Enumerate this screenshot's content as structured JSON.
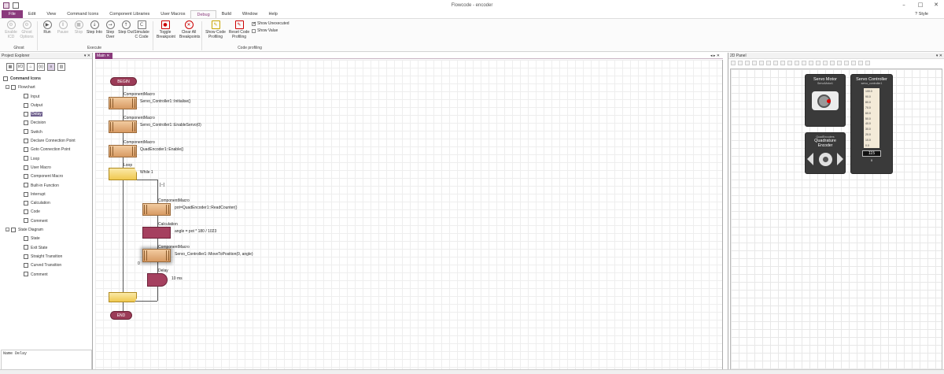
{
  "window": {
    "title": "Flowcode - encoder",
    "style_label": "Style"
  },
  "menu": [
    "File",
    "Edit",
    "View",
    "Command Icons",
    "Component Libraries",
    "User Macros",
    "Debug",
    "Build",
    "Window",
    "Help"
  ],
  "ribbon": {
    "buttons": [
      {
        "label": "Enable ICD",
        "icon": "⚙",
        "disabled": true
      },
      {
        "label": "Ghost Options",
        "icon": "⚙",
        "disabled": true
      },
      {
        "label": "Run",
        "icon": "▶"
      },
      {
        "label": "Pause",
        "icon": "Ⅱ",
        "disabled": true
      },
      {
        "label": "Stop",
        "icon": "■",
        "disabled": true
      },
      {
        "label": "Step Into",
        "icon": "↓"
      },
      {
        "label": "Step Over",
        "icon": "→"
      },
      {
        "label": "Step Out",
        "icon": "↑"
      },
      {
        "label": "Simulate C Code",
        "icon": "C"
      },
      {
        "label": "Toggle Breakpoint",
        "icon": "●"
      },
      {
        "label": "Clear All Breakpoints",
        "icon": "✕"
      },
      {
        "label": "Show Code Profiling",
        "icon": "✎"
      },
      {
        "label": "Reset Code Profiling",
        "icon": "✎"
      }
    ],
    "groups": {
      "ghost": "Ghost",
      "execute": "Execute",
      "profiling": "Code profiling"
    },
    "checks": {
      "unexecuted": "Show Unexecuted",
      "value": "Show Value"
    }
  },
  "explorer": {
    "title": "Project Explorer",
    "root": "Command Icons",
    "flowchart": "Flowchart",
    "flow_items": [
      "Input",
      "Output",
      "Delay",
      "Decision",
      "Switch",
      "Declare Connection Point",
      "Goto Connection Point",
      "Loop",
      "User Macro",
      "Component Macro",
      "Built-in Function",
      "Interrupt",
      "Calculation",
      "Code",
      "Comment"
    ],
    "state": "State Diagram",
    "state_items": [
      "State",
      "Exit State",
      "Straight Transition",
      "Curved Transition",
      "Comment"
    ],
    "name_box": "Name Delay"
  },
  "main": {
    "tab": "Main",
    "begin": "BEGIN",
    "end": "END",
    "component_macro": "ComponentMacro",
    "calc_label": "Calculation",
    "delay_label": "Delay",
    "loop_label": "Loop",
    "code1": "Servo_Controller1::Initialise()",
    "code2": "Servo_Controller1::EnableServo(0)",
    "code3": "QuadEncoder1::Enable()",
    "loop_cond": "While 1",
    "empty_branch": "[--]",
    "code4": "pot=QuadEncoder1::ReadCounter()",
    "code5": "angle = pot * 180 / 1023",
    "code6": "Servo_Controller1::MoveToPosition(0, angle)",
    "code7": "10 ms",
    "bp_marker": "0"
  },
  "panel2d": {
    "title": "2D Panel",
    "servo_motor": "Servo Motor",
    "servo_motor_sub": "ServoMotor1",
    "servo_ctrl": "Servo Controller",
    "servo_ctrl_sub": "servo_controller1",
    "quad_title": "QuadEncoders",
    "quad_name": "Quadrature",
    "quad_sub": "Encoder",
    "value_box": "115",
    "zero": "0",
    "scale": [
      "100.0",
      "90.0",
      "80.0",
      "70.0",
      "60.0",
      "50.0",
      "40.0",
      "30.0",
      "20.0",
      "10.0",
      "0.0"
    ]
  }
}
